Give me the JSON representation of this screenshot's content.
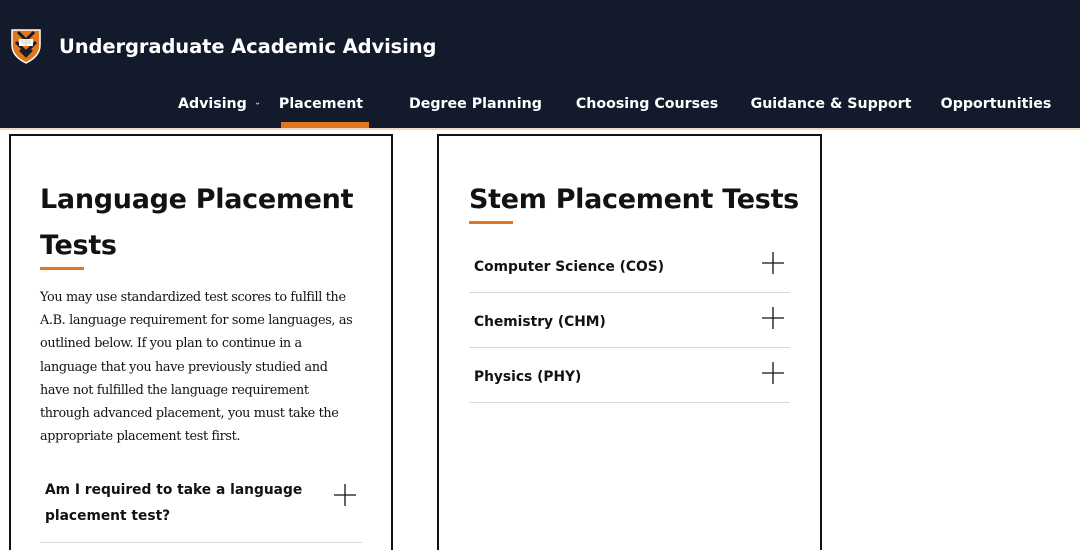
{
  "header": {
    "logo_icon": "princeton-shield-icon",
    "site_title": "Undergraduate Academic Advising",
    "background_color": "#121a2c",
    "accent_color": "#e0771f"
  },
  "nav": {
    "items": [
      {
        "label": "Advising",
        "has_dropdown": true,
        "active": false
      },
      {
        "label": "Placement",
        "has_dropdown": true,
        "active": true
      },
      {
        "label": "Degree Planning",
        "has_dropdown": true,
        "active": false
      },
      {
        "label": "Choosing Courses",
        "has_dropdown": true,
        "active": false
      },
      {
        "label": "Guidance & Support",
        "has_dropdown": true,
        "active": false
      },
      {
        "label": "Opportunities",
        "has_dropdown": false,
        "active": false
      }
    ]
  },
  "language_card": {
    "title_line1": "Language Placement",
    "title_line2": "Tests",
    "intro_lines": [
      "You may use standardized test scores to fulfill the",
      "A.B. language requirement for some languages, as",
      "outlined below. If you plan to continue in a",
      "language that you have previously studied and",
      "have not fulfilled the language requirement",
      "through advanced placement, you must take the",
      "appropriate placement test first."
    ],
    "accordion": [
      {
        "label_line1": "Am I required to take a language",
        "label_line2": "placement test?",
        "expanded": false,
        "icon": "plus-icon"
      }
    ]
  },
  "stem_card": {
    "title": "Stem Placement Tests",
    "accordion": [
      {
        "label": "Computer Science (COS)",
        "expanded": false,
        "icon": "plus-icon"
      },
      {
        "label": "Chemistry (CHM)",
        "expanded": false,
        "icon": "plus-icon"
      },
      {
        "label": "Physics (PHY)",
        "expanded": false,
        "icon": "plus-icon"
      }
    ]
  }
}
